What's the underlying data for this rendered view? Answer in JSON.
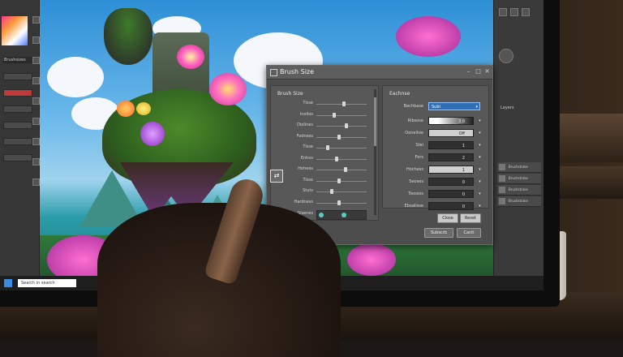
{
  "left_toolbar": {
    "panel_label": "Brushsizes"
  },
  "right_panel": {
    "layers_title": "Layers",
    "layers": [
      "Brushstroke",
      "Brushstroke",
      "Brushstroke",
      "Brushstroke"
    ]
  },
  "taskbar": {
    "search_placeholder": "Search in search"
  },
  "dialog": {
    "title": "Brush Size",
    "left_pane": {
      "label": "Brush Size",
      "sliders": [
        {
          "label": "Tisse",
          "value": 0.55
        },
        {
          "label": "Inollos",
          "value": 0.35
        },
        {
          "label": "Diolines",
          "value": 0.6
        },
        {
          "label": "Fodness",
          "value": 0.45
        },
        {
          "label": "Tisse",
          "value": 0.2
        },
        {
          "label": "Enhos",
          "value": 0.4
        },
        {
          "label": "Hohees",
          "value": 0.58
        },
        {
          "label": "Tisso",
          "value": 0.44
        },
        {
          "label": "Stuts",
          "value": 0.3
        },
        {
          "label": "Hardness",
          "value": 0.44
        }
      ],
      "preview_label": "Sisenes"
    },
    "right_pane": {
      "label": "Eachnse",
      "select": {
        "label": "Bechbase",
        "value": "Subi"
      },
      "fields": [
        {
          "label": "Ribsose",
          "value": "3.0"
        },
        {
          "label": "Ooneitoe",
          "value": "Off"
        },
        {
          "label": "Stei",
          "value": "1"
        },
        {
          "label": "Fors",
          "value": "2"
        },
        {
          "label": "Hochess",
          "value": "1"
        },
        {
          "label": "Seoses",
          "value": "0"
        },
        {
          "label": "Tsosess",
          "value": "0"
        },
        {
          "label": "Eboalisse",
          "value": "0"
        }
      ],
      "btn_close": "Close",
      "btn_reset": "Reset"
    },
    "btn_subscribe": "Subscrb",
    "btn_cancel": "Cantl"
  }
}
